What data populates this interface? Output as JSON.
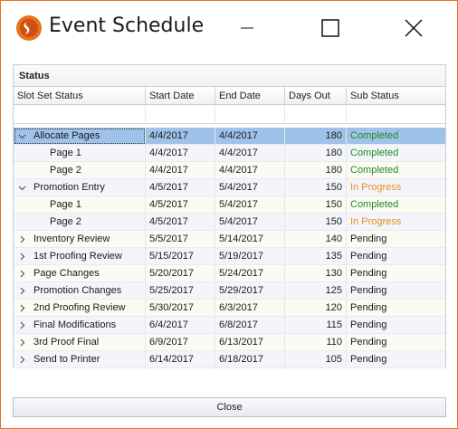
{
  "window": {
    "title": "Event Schedule"
  },
  "panel": {
    "title": "Status"
  },
  "columns": [
    "Slot Set Status",
    "Start Date",
    "End Date",
    "Days Out",
    "Sub Status"
  ],
  "rows": [
    {
      "name": "Allocate Pages",
      "level": 0,
      "toggle": "expanded",
      "start": "4/4/2017",
      "end": "4/4/2017",
      "days": "180",
      "sub": "Completed",
      "selected": true
    },
    {
      "name": "Page 1",
      "level": 1,
      "toggle": "none",
      "start": "4/4/2017",
      "end": "4/4/2017",
      "days": "180",
      "sub": "Completed"
    },
    {
      "name": "Page 2",
      "level": 1,
      "toggle": "none",
      "start": "4/4/2017",
      "end": "4/4/2017",
      "days": "180",
      "sub": "Completed"
    },
    {
      "name": "Promotion Entry",
      "level": 0,
      "toggle": "expanded",
      "start": "4/5/2017",
      "end": "5/4/2017",
      "days": "150",
      "sub": "In Progress"
    },
    {
      "name": "Page 1",
      "level": 1,
      "toggle": "none",
      "start": "4/5/2017",
      "end": "5/4/2017",
      "days": "150",
      "sub": "Completed"
    },
    {
      "name": "Page 2",
      "level": 1,
      "toggle": "none",
      "start": "4/5/2017",
      "end": "5/4/2017",
      "days": "150",
      "sub": "In Progress"
    },
    {
      "name": "Inventory Review",
      "level": 0,
      "toggle": "collapsed",
      "start": "5/5/2017",
      "end": "5/14/2017",
      "days": "140",
      "sub": "Pending"
    },
    {
      "name": "1st Proofing Review",
      "level": 0,
      "toggle": "collapsed",
      "start": "5/15/2017",
      "end": "5/19/2017",
      "days": "135",
      "sub": "Pending"
    },
    {
      "name": "Page Changes",
      "level": 0,
      "toggle": "collapsed",
      "start": "5/20/2017",
      "end": "5/24/2017",
      "days": "130",
      "sub": "Pending"
    },
    {
      "name": "Promotion Changes",
      "level": 0,
      "toggle": "collapsed",
      "start": "5/25/2017",
      "end": "5/29/2017",
      "days": "125",
      "sub": "Pending"
    },
    {
      "name": "2nd Proofing Review",
      "level": 0,
      "toggle": "collapsed",
      "start": "5/30/2017",
      "end": "6/3/2017",
      "days": "120",
      "sub": "Pending"
    },
    {
      "name": "Final Modifications",
      "level": 0,
      "toggle": "collapsed",
      "start": "6/4/2017",
      "end": "6/8/2017",
      "days": "115",
      "sub": "Pending"
    },
    {
      "name": "3rd Proof Final",
      "level": 0,
      "toggle": "collapsed",
      "start": "6/9/2017",
      "end": "6/13/2017",
      "days": "110",
      "sub": "Pending"
    },
    {
      "name": "Send to Printer",
      "level": 0,
      "toggle": "collapsed",
      "start": "6/14/2017",
      "end": "6/18/2017",
      "days": "105",
      "sub": "Pending"
    }
  ],
  "status_colors": {
    "Completed": "#1e8b1e",
    "In Progress": "#e58f1f",
    "Pending": "#1a1a1a"
  },
  "footer": {
    "close_label": "Close"
  }
}
